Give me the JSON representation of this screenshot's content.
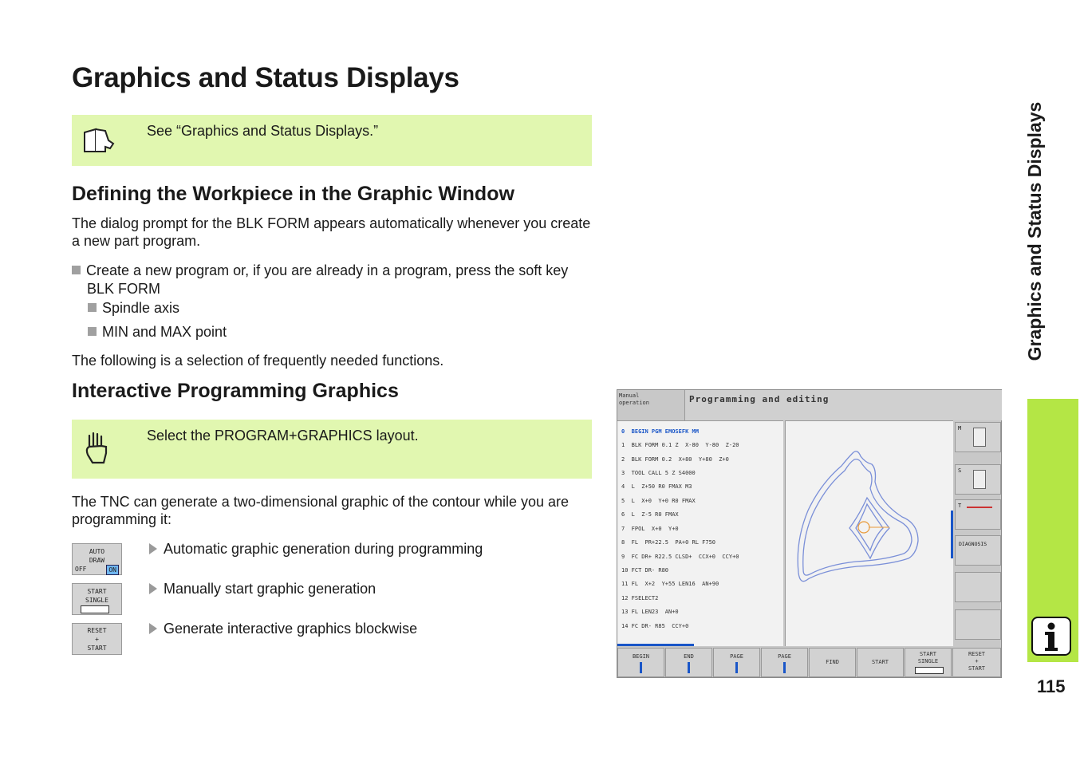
{
  "title": "Graphics and Status Displays",
  "note1": {
    "text": "See “Graphics and Status Displays.”"
  },
  "section1": {
    "heading": "Defining the Workpiece in the Graphic Window",
    "intro": "The dialog prompt for the BLK FORM appears automatically whenever you create a new part program.",
    "bullet_main": "Create a new program or, if you are already in a program, press the soft key BLK FORM",
    "sub_bullets": [
      "Spindle axis",
      "MIN and MAX point"
    ],
    "outro": "The following is a selection of frequently needed functions."
  },
  "section2": {
    "heading": "Interactive Programming Graphics",
    "note": "Select the PROGRAM+GRAPHICS layout.",
    "intro": "The TNC can generate a two-dimensional graphic of the contour while you are programming it:",
    "items": [
      {
        "key_lines": [
          "AUTO",
          "DRAW"
        ],
        "key_off": "OFF",
        "key_on": "ON",
        "desc": "Automatic graphic generation during programming"
      },
      {
        "key_lines": [
          "START",
          "SINGLE"
        ],
        "desc": "Manually start graphic generation"
      },
      {
        "key_lines": [
          "RESET",
          "+",
          "START"
        ],
        "desc": "Generate interactive graphics blockwise"
      }
    ]
  },
  "sidebar": {
    "title": "Graphics and Status Displays",
    "page_number": "115"
  },
  "screen": {
    "mode_line1": "Manual",
    "mode_line2": "operation",
    "header": "Programming and editing",
    "program_lines": [
      "0  BEGIN PGM EMOSEFK MM",
      "1  BLK FORM 0.1 Z  X-80  Y-80  Z-20",
      "2  BLK FORM 0.2  X+80  Y+80  Z+0",
      "3  TOOL CALL 5 Z S4000",
      "4  L  Z+50 R0 FMAX M3",
      "5  L  X+0  Y+0 R0 FMAX",
      "6  L  Z-5 R0 FMAX",
      "7  FPOL  X+0  Y+0",
      "8  FL  PR+22.5  PA+0 RL F750",
      "9  FC DR+ R22.5 CLSD+  CCX+0  CCY+0",
      "10 FCT DR- R80",
      "11 FL  X+2  Y+55 LEN16  AN+90",
      "12 FSELECT2",
      "13 FL LEN23  AN+0",
      "14 FC DR- R85  CCY+0"
    ],
    "side_labels": [
      "M",
      "S",
      "T",
      "DIAGNOSIS"
    ],
    "softkeys": [
      [
        "BEGIN"
      ],
      [
        "END"
      ],
      [
        "PAGE"
      ],
      [
        "PAGE"
      ],
      [
        "FIND"
      ],
      [
        "START"
      ],
      [
        "START",
        "SINGLE"
      ],
      [
        "RESET",
        "+",
        "START"
      ]
    ],
    "accent_color": "#1a56c8"
  }
}
